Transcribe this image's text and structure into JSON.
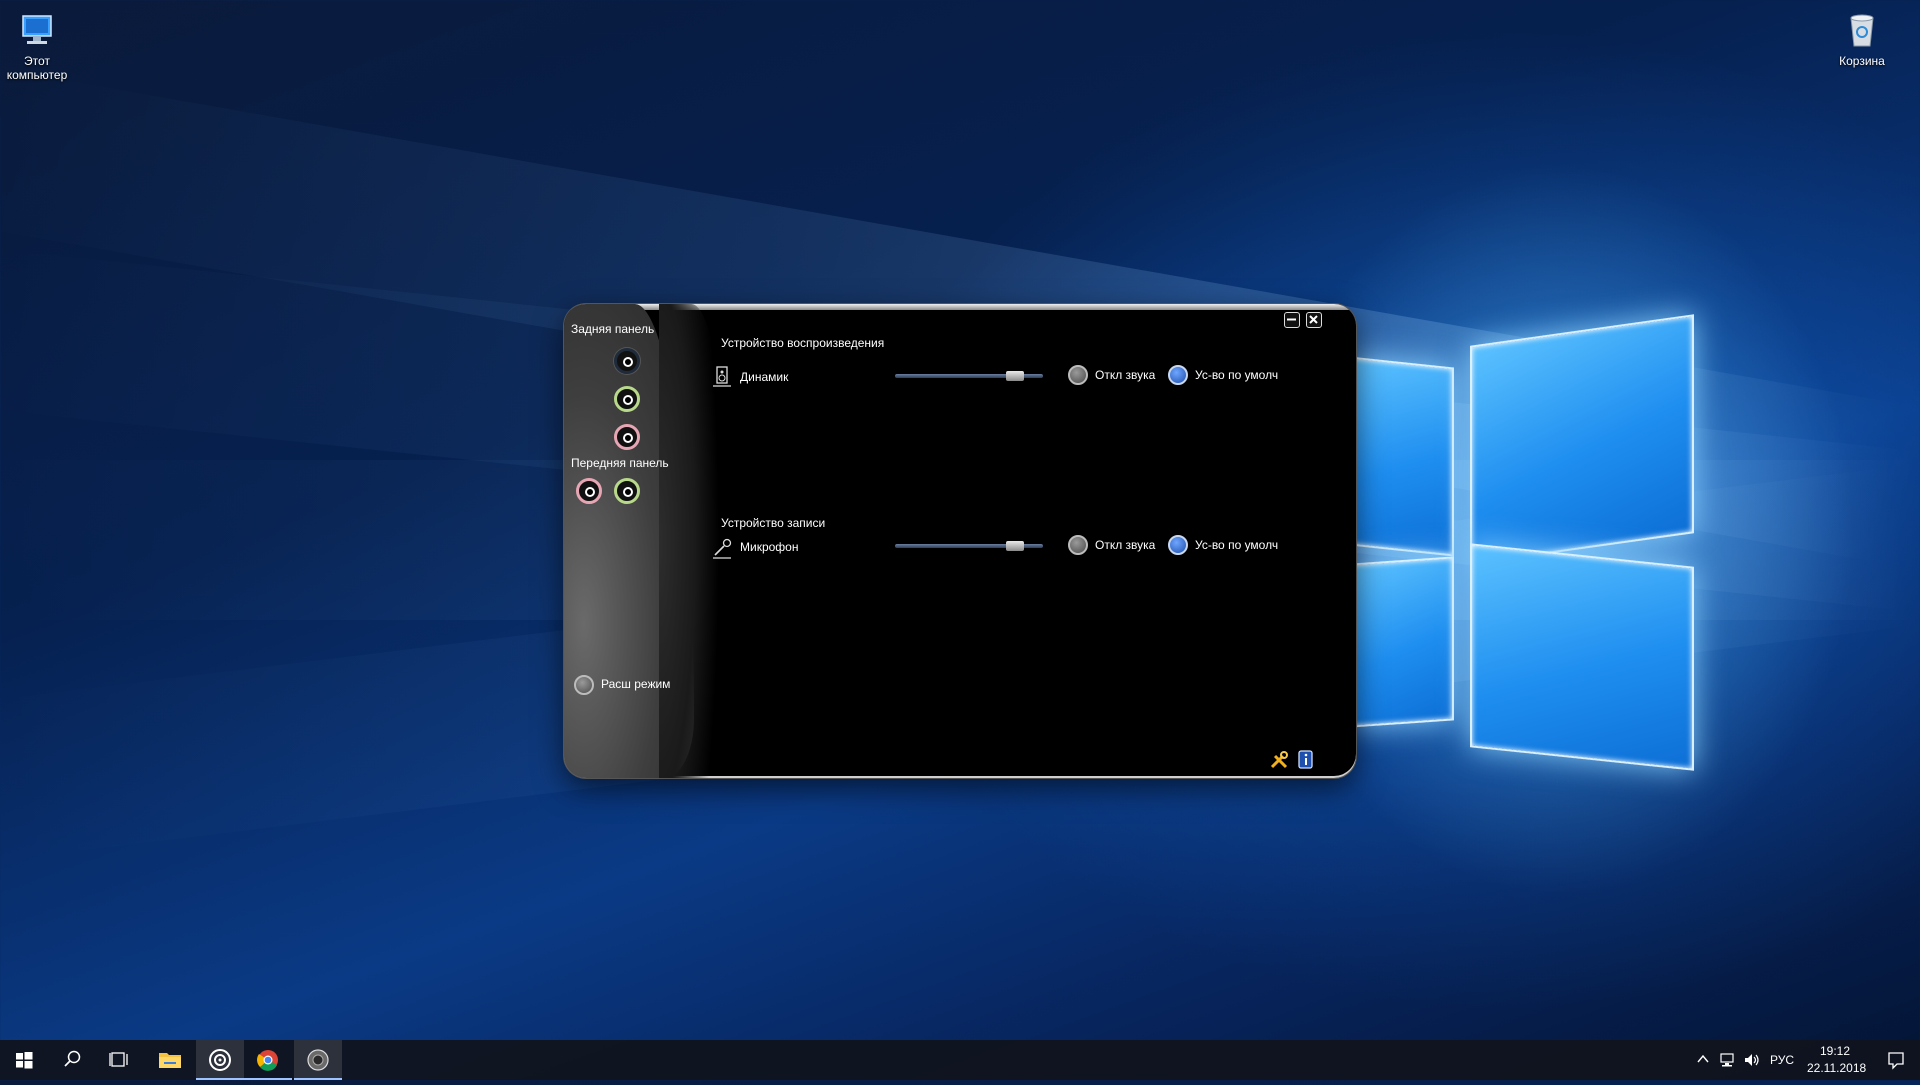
{
  "desktop": {
    "icons": [
      {
        "label": "Этот компьютер",
        "line1": "Этот",
        "line2": "компьютер"
      },
      {
        "label": "Корзина"
      }
    ]
  },
  "app": {
    "sidebar": {
      "rear_panel_label": "Задняя панель",
      "front_panel_label": "Передняя панель",
      "advanced_mode_label": "Расш режим"
    },
    "playback": {
      "section_label": "Устройство воспроизведения",
      "device_name": "Динамик",
      "mute_label": "Откл звука",
      "default_label": "Ус-во по умолч",
      "volume": 0.85
    },
    "recording": {
      "section_label": "Устройство записи",
      "device_name": "Микрофон",
      "mute_label": "Откл звука",
      "default_label": "Ус-во по умолч",
      "volume": 0.85
    },
    "colors": {
      "accent": "#1e4fae",
      "jack_green": "#b8d88a",
      "jack_pink": "#e7a6b4"
    }
  },
  "taskbar": {
    "language": "РУС",
    "time": "19:12",
    "date": "22.11.2018"
  }
}
